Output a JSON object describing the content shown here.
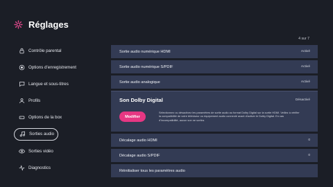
{
  "header": {
    "title": "Réglages"
  },
  "counter": "4 sur 7",
  "sidebar": {
    "items": [
      {
        "label": "Contrôle parental"
      },
      {
        "label": "Options d'enregistrement"
      },
      {
        "label": "Langue et sous-titres"
      },
      {
        "label": "Profils"
      },
      {
        "label": "Options de la box"
      },
      {
        "label": "Sorties audio"
      },
      {
        "label": "Sorties vidéo"
      },
      {
        "label": "Diagnostics"
      }
    ]
  },
  "settings": {
    "hdmi_out": {
      "label": "Sortie audio numérique HDMI",
      "status": "Activé"
    },
    "spdif_out": {
      "label": "Sortie audio numérique S/PDIF",
      "status": "Activé"
    },
    "analog_out": {
      "label": "Sortie audio analogique",
      "status": "Activé"
    },
    "dolby": {
      "label": "Son Dolby Digital",
      "status": "Désactivé",
      "button": "Modifier",
      "description": "Sélectionnez ou désactivez les paramètres de sortie audio au format Dolby Digital sur la sortie HDMI. Veillez à vérifier la compatibilité de votre téléviseur ou équipement audio connecté avant d'activer le Dolby Digital. En cas d'incompatibilité, aucun son ne sortira."
    },
    "hdmi_delay": {
      "label": "Décalage audio HDMI",
      "value": "0"
    },
    "spdif_delay": {
      "label": "Décalage audio S/PDIF",
      "value": "0"
    },
    "reset": {
      "label": "Réinitialiser tous les paramètres audio"
    }
  },
  "colors": {
    "accent": "#e63783",
    "background": "#1b1e26",
    "row": "#333b54"
  }
}
